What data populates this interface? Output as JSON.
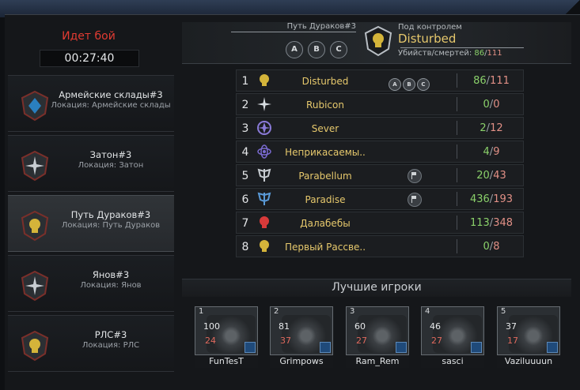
{
  "status": {
    "title": "Идет бой",
    "timer": "00:27:40"
  },
  "locations": [
    {
      "name": "Армейские склады#3",
      "sub": "Локация: Армейские склады",
      "icon": "army-warehouse-emblem-icon",
      "color": "#2a7fbf"
    },
    {
      "name": "Затон#3",
      "sub": "Локация: Затон",
      "icon": "compass-star-emblem-icon",
      "color": "#c8cdd2"
    },
    {
      "name": "Путь Дураков#3",
      "sub": "Локация: Путь Дураков",
      "icon": "skull-emblem-icon",
      "color": "#d4b43a"
    },
    {
      "name": "Янов#3",
      "sub": "Локация: Янов",
      "icon": "compass-star-emblem-icon",
      "color": "#c8cdd2"
    },
    {
      "name": "РЛС#3",
      "sub": "Локация: РЛС",
      "icon": "skull-emblem-icon",
      "color": "#d4b43a"
    }
  ],
  "header": {
    "sector": "Путь Дураков#3",
    "letters": [
      "A",
      "B",
      "C"
    ],
    "control_label": "Под контролем",
    "clan": "Disturbed",
    "kd_label": "Убийств/смертей:",
    "kills": "86",
    "deaths": "111"
  },
  "rankings": [
    {
      "rank": "1",
      "name": "Disturbed",
      "kills": "86",
      "deaths": "111",
      "badges": [
        "A",
        "B",
        "C"
      ],
      "flag": false,
      "icon": "skull-emblem-icon",
      "color": "#d4b43a"
    },
    {
      "rank": "2",
      "name": "Rubicon",
      "kills": "0",
      "deaths": "0",
      "badges": [],
      "flag": false,
      "icon": "compass-star-emblem-icon",
      "color": "#d8dde2"
    },
    {
      "rank": "3",
      "name": "Sever",
      "kills": "2",
      "deaths": "12",
      "badges": [],
      "flag": false,
      "icon": "star-emblem-icon",
      "color": "#8a7ad8"
    },
    {
      "rank": "4",
      "name": "Неприкасаемы..",
      "kills": "4",
      "deaths": "9",
      "badges": [],
      "flag": false,
      "icon": "atom-emblem-icon",
      "color": "#7a6ad0"
    },
    {
      "rank": "5",
      "name": "Parabellum",
      "kills": "20",
      "deaths": "43",
      "badges": [],
      "flag": true,
      "icon": "wings-emblem-icon",
      "color": "#c8cdd2"
    },
    {
      "rank": "6",
      "name": "Paradise",
      "kills": "436",
      "deaths": "193",
      "badges": [],
      "flag": true,
      "icon": "wings-emblem-icon",
      "color": "#5a9ad8"
    },
    {
      "rank": "7",
      "name": "Далабебы",
      "kills": "113",
      "deaths": "348",
      "badges": [],
      "flag": false,
      "icon": "red-skull-emblem-icon",
      "color": "#d83a3a"
    },
    {
      "rank": "8",
      "name": "Первый Рассве..",
      "kills": "0",
      "deaths": "8",
      "badges": [],
      "flag": false,
      "icon": "skull-emblem-icon",
      "color": "#d4b43a"
    }
  ],
  "best": {
    "title": "Лучшие игроки",
    "players": [
      {
        "num": "1",
        "kills": "100",
        "deaths": "24",
        "name": "FunTesT"
      },
      {
        "num": "2",
        "kills": "81",
        "deaths": "37",
        "name": "Grimpows"
      },
      {
        "num": "3",
        "kills": "60",
        "deaths": "27",
        "name": "Ram_Rem"
      },
      {
        "num": "4",
        "kills": "46",
        "deaths": "27",
        "name": "sasci"
      },
      {
        "num": "5",
        "kills": "37",
        "deaths": "17",
        "name": "Vaziluuuun"
      }
    ]
  }
}
